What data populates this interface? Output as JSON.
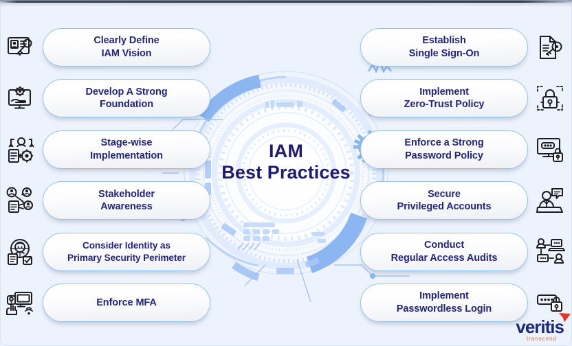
{
  "background_color": "#edf3fd",
  "accent_blue": "#7fadf0",
  "pill_border": "#93c4e8",
  "text_navy": "#23257c",
  "center": {
    "title_line1": "IAM",
    "title_line2": "Best Practices"
  },
  "left_column": [
    {
      "label": "Clearly Define\nIAM Vision",
      "icon": "id-card-key-icon"
    },
    {
      "label": "Develop A Strong\nFoundation",
      "icon": "monitor-gear-hand-icon"
    },
    {
      "label": "Stage-wise\nImplementation",
      "icon": "process-user-gear-icon"
    },
    {
      "label": "Stakeholder\nAwareness",
      "icon": "stakeholder-network-icon"
    },
    {
      "label": "Consider Identity as\nPrimary Security Perimeter",
      "icon": "identity-perimeter-icon"
    },
    {
      "label": "Enforce MFA",
      "icon": "mfa-fingerprint-icon"
    }
  ],
  "right_column": [
    {
      "label": "Establish\nSingle Sign-On",
      "icon": "document-key-icon"
    },
    {
      "label": "Implement\nZero-Trust Policy",
      "icon": "padlock-scan-icon"
    },
    {
      "label": "Enforce a Strong\nPassword Policy",
      "icon": "password-monitor-lock-icon"
    },
    {
      "label": "Secure\nPrivileged Accounts",
      "icon": "privileged-user-chat-icon"
    },
    {
      "label": "Conduct\nRegular Access Audits",
      "icon": "access-audit-network-icon"
    },
    {
      "label": "Implement\nPasswordless Login",
      "icon": "passwordless-keypad-lock-icon"
    }
  ],
  "logo": {
    "wordmark": "veritis",
    "tagline": "transcend",
    "mark_color": "#e2342b"
  }
}
